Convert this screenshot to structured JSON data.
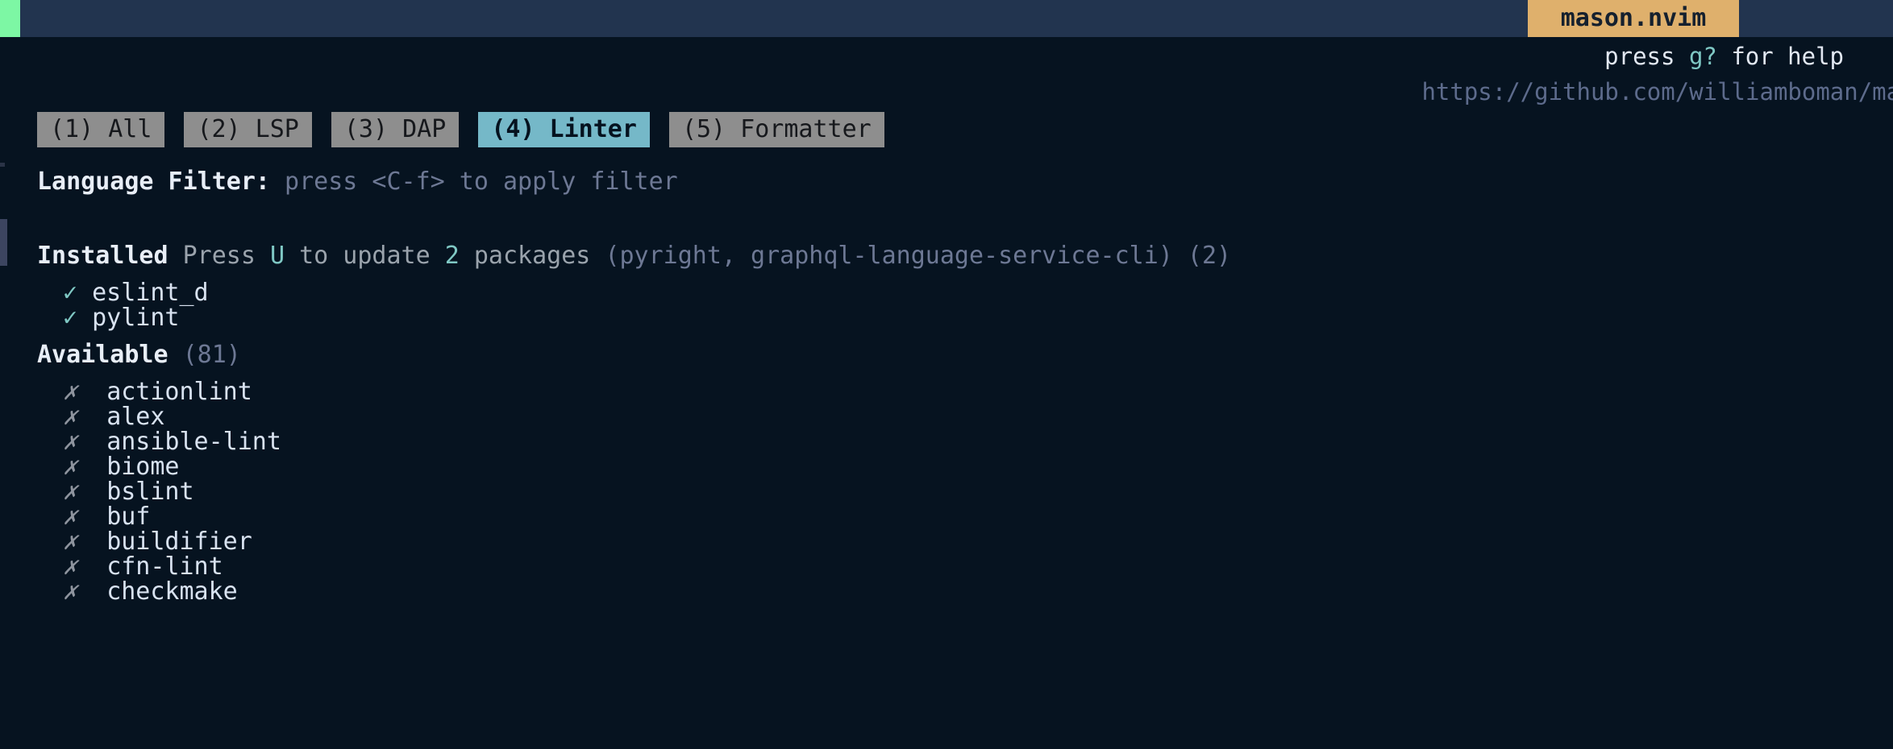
{
  "window": {
    "title": "mason.nvim",
    "background": "#061320",
    "header_background": "#22344f",
    "title_tab_background": "#dfb06c",
    "cursor_block_color": "#7df7a4"
  },
  "help": {
    "prefix": "press ",
    "key": "g?",
    "suffix": " for help",
    "url": "https://github.com/williamboman/maso"
  },
  "tabs": [
    {
      "label": "(1) All",
      "active": false
    },
    {
      "label": "(2) LSP",
      "active": false
    },
    {
      "label": "(3) DAP",
      "active": false
    },
    {
      "label": "(4) Linter",
      "active": true
    },
    {
      "label": "(5) Formatter",
      "active": false
    }
  ],
  "language_filter": {
    "label": "Language Filter:",
    "hint": " press <C-f> to apply filter"
  },
  "installed": {
    "heading": "Installed",
    "hint_pre": " Press ",
    "hint_key": "U",
    "hint_mid": " to update ",
    "hint_count": "2",
    "hint_post": " packages ",
    "packages_list": "(pyright, graphql-language-service-cli)",
    "count": "(2)",
    "items": [
      {
        "mark": "✓",
        "name": "eslint_d"
      },
      {
        "mark": "✓",
        "name": "pylint"
      }
    ]
  },
  "available": {
    "heading": "Available",
    "count": "(81)",
    "items": [
      {
        "mark": "✗",
        "name": "actionlint"
      },
      {
        "mark": "✗",
        "name": "alex"
      },
      {
        "mark": "✗",
        "name": "ansible-lint"
      },
      {
        "mark": "✗",
        "name": "biome"
      },
      {
        "mark": "✗",
        "name": "bslint"
      },
      {
        "mark": "✗",
        "name": "buf"
      },
      {
        "mark": "✗",
        "name": "buildifier"
      },
      {
        "mark": "✗",
        "name": "cfn-lint"
      },
      {
        "mark": "✗",
        "name": "checkmake"
      }
    ]
  }
}
